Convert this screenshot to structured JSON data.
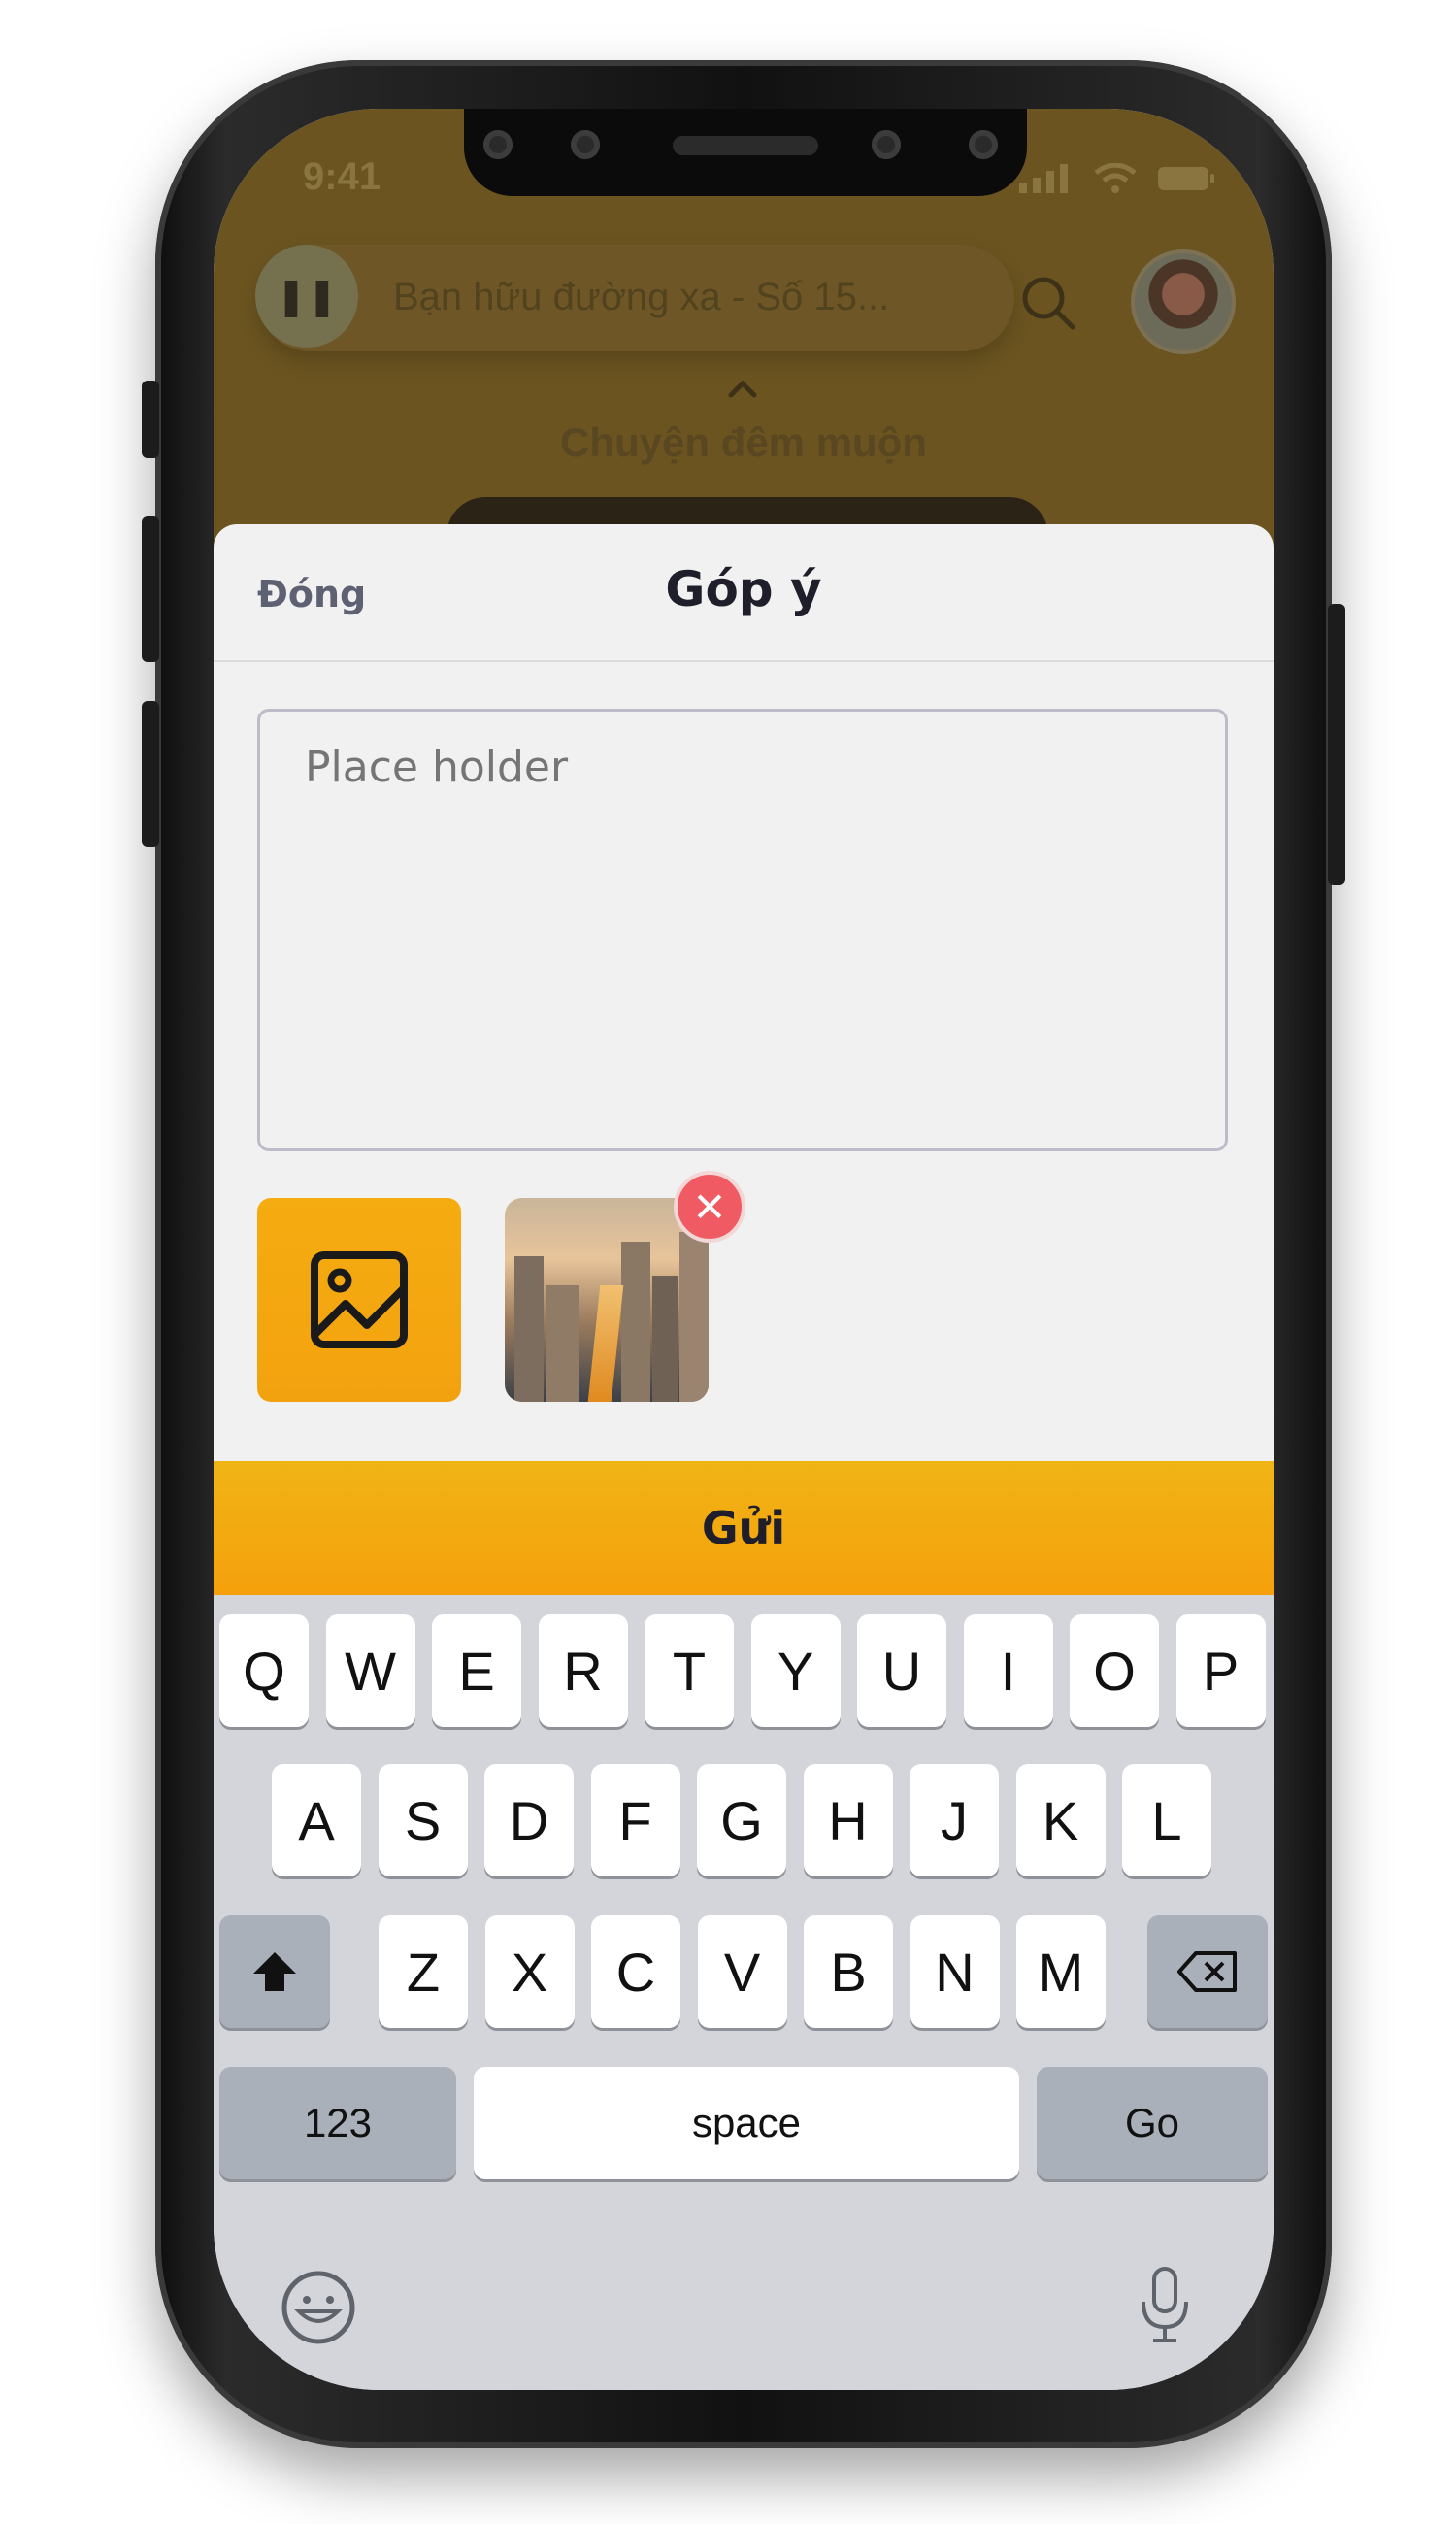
{
  "status_bar": {
    "time": "9:41"
  },
  "background_app": {
    "now_playing": "Bạn hữu đường xa - Số 15...",
    "section_title": "Chuyện đêm muộn"
  },
  "sheet": {
    "close_label": "Đóng",
    "title": "Góp ý",
    "textarea_placeholder": "Place holder",
    "submit_label": "Gửi"
  },
  "colors": {
    "accent": "#F5A60F",
    "remove": "#F05A63",
    "title_text": "#1E1F2B"
  },
  "keyboard": {
    "row1": [
      "Q",
      "W",
      "E",
      "R",
      "T",
      "Y",
      "U",
      "I",
      "O",
      "P"
    ],
    "row2": [
      "A",
      "S",
      "D",
      "F",
      "G",
      "H",
      "J",
      "K",
      "L"
    ],
    "row3": [
      "Z",
      "X",
      "C",
      "V",
      "B",
      "N",
      "M"
    ],
    "numbers_label": "123",
    "space_label": "space",
    "go_label": "Go"
  },
  "icons": [
    "pause-icon",
    "search-icon",
    "avatar",
    "chevron-up-icon",
    "image-icon",
    "close-icon",
    "shift-icon",
    "backspace-icon",
    "emoji-icon",
    "microphone-icon"
  ]
}
